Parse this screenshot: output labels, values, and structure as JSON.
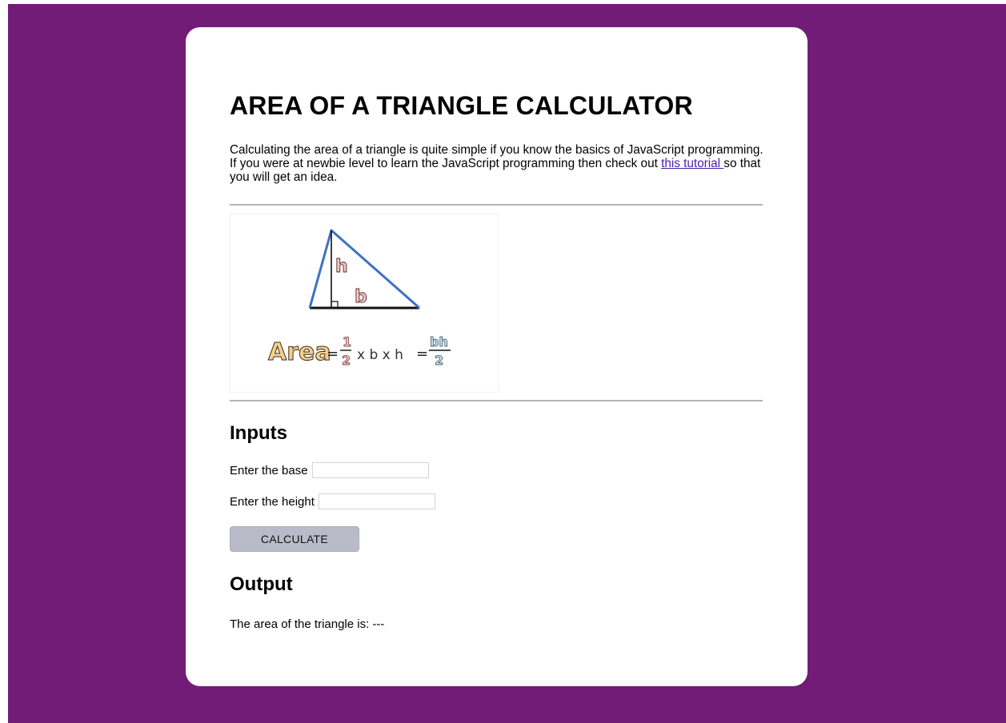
{
  "page": {
    "title": "AREA OF A TRIANGLE CALCULATOR",
    "intro_before_link": "Calculating the area of a triangle is quite simple if you know the basics of JavaScript programming. If you were at newbie level to learn the JavaScript programming then check out ",
    "intro_link": "this tutorial ",
    "intro_after_link": "so that you will get an idea."
  },
  "figure": {
    "label_height": "h",
    "label_base": "b",
    "formula_word": "Area",
    "formula_equals": "=",
    "formula_numerator_1": "1",
    "formula_denominator_1": "2",
    "formula_middle": "x b x h",
    "formula_numerator_2": "bh",
    "formula_denominator_2": "2",
    "colors": {
      "triangle_edge": "#3d72c4",
      "base_line": "#111111",
      "label_fill": "#f5c4c4",
      "label_stroke": "#5a2a2a",
      "formula_word_fill": "#f5d08a",
      "formula_fraction_fill": "#cde8f0"
    }
  },
  "inputs": {
    "heading": "Inputs",
    "base_label": "Enter the base",
    "base_value": "",
    "height_label": "Enter the height",
    "height_value": "",
    "calculate_label": "CALCULATE"
  },
  "output": {
    "heading": "Output",
    "result_text": "The area of the triangle is: ---"
  },
  "theme": {
    "background": "#731c77",
    "card": "#ffffff",
    "button": "#b9bcc8"
  }
}
